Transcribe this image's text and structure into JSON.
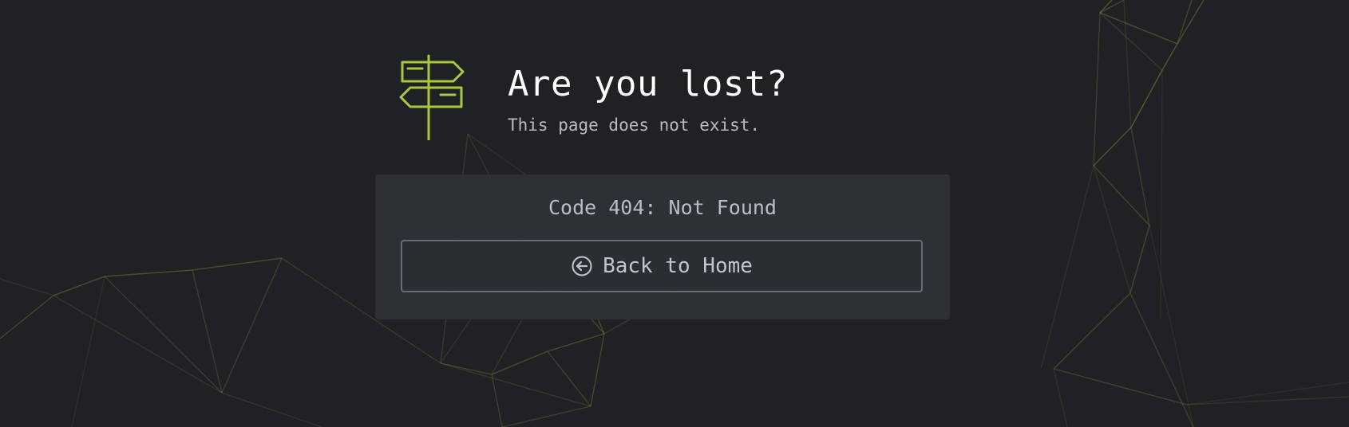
{
  "background": {
    "color": "#202125",
    "network_color": "#8fb13c"
  },
  "hero": {
    "icon": "signpost-icon",
    "icon_color": "#a8c83f",
    "title": "Are you lost?",
    "subtitle": "This page does not exist."
  },
  "error": {
    "code_text": "Code 404: Not Found"
  },
  "home_button": {
    "icon": "circle-arrow-left-icon",
    "label": "Back to Home"
  }
}
